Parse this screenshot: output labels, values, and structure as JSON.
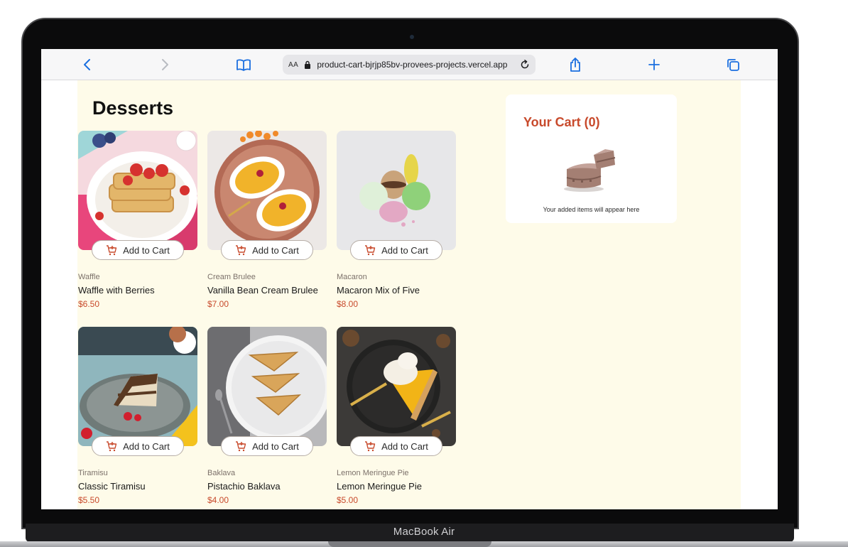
{
  "device": {
    "label": "MacBook Air"
  },
  "browser": {
    "address_prefix": "AA",
    "url": "product-cart-bjrjp85bv-provees-projects.vercel.app",
    "icons": [
      "chevron-left-icon",
      "chevron-right-icon",
      "book-icon",
      "lock-icon",
      "reload-icon",
      "share-icon",
      "plus-icon",
      "tabs-icon"
    ],
    "accent": "#1b6fe0"
  },
  "page": {
    "title": "Desserts",
    "background": "#fefbe9",
    "accent": "#c84a2c"
  },
  "products": [
    {
      "category": "Waffle",
      "name": "Waffle with Berries",
      "price": "$6.50",
      "button": "Add to Cart"
    },
    {
      "category": "Cream Brulee",
      "name": "Vanilla Bean Cream Brulee",
      "price": "$7.00",
      "button": "Add to Cart"
    },
    {
      "category": "Macaron",
      "name": "Macaron Mix of Five",
      "price": "$8.00",
      "button": "Add to Cart"
    },
    {
      "category": "Tiramisu",
      "name": "Classic Tiramisu",
      "price": "$5.50",
      "button": "Add to Cart"
    },
    {
      "category": "Baklava",
      "name": "Pistachio Baklava",
      "price": "$4.00",
      "button": "Add to Cart"
    },
    {
      "category": "Lemon Meringue Pie",
      "name": "Lemon Meringue Pie",
      "price": "$5.00",
      "button": "Add to Cart"
    }
  ],
  "cart": {
    "title": "Your Cart (0)",
    "empty_message": "Your added items will appear here"
  }
}
